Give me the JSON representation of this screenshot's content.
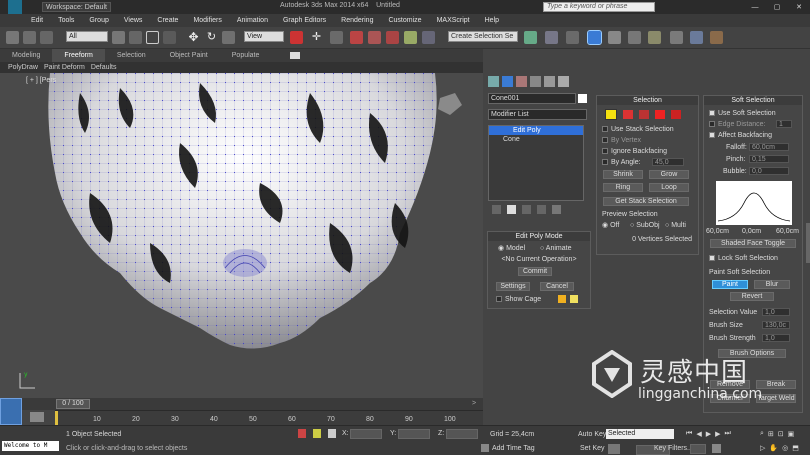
{
  "title_bar": {
    "workspace": "Workspace: Default",
    "title": "Autodesk 3ds Max  2014 x64",
    "doc": "Untitled",
    "search_placeholder": "Type a keyword or phrase"
  },
  "menu": [
    "Edit",
    "Tools",
    "Group",
    "Views",
    "Create",
    "Modifiers",
    "Animation",
    "Graph Editors",
    "Rendering",
    "Customize",
    "MAXScript",
    "Help"
  ],
  "toolbar": {
    "filter": "All",
    "coord": "View",
    "selection_set": "Create Selection Se"
  },
  "ribbon": {
    "tabs": [
      "Modeling",
      "Freeform",
      "Selection",
      "Object Paint",
      "Populate"
    ],
    "active": "Freeform",
    "subtabs": [
      "PolyDraw",
      "Paint Deform",
      "Defaults"
    ]
  },
  "viewport": {
    "label": "[ + ] [Pers"
  },
  "command_panel": {
    "object_name": "Cone001",
    "modifier_list": "Modifier List",
    "stack": [
      "Edit Poly",
      "Cone"
    ],
    "edit_poly_mode": {
      "title": "Edit Poly Mode",
      "model": "Model",
      "animate": "Animate",
      "current_op": "<No Current Operation>",
      "commit": "Commit",
      "settings": "Settings",
      "cancel": "Cancel",
      "show_cage": "Show Cage"
    },
    "selection": {
      "title": "Selection",
      "use_stack": "Use Stack Selection",
      "by_vertex": "By Vertex",
      "ignore_backfacing": "Ignore Backfacing",
      "by_angle": "By Angle:",
      "angle_value": "45,0",
      "shrink": "Shrink",
      "grow": "Grow",
      "ring": "Ring",
      "loop": "Loop",
      "get_stack": "Get Stack Selection",
      "preview_title": "Preview Selection",
      "off": "Off",
      "subobj": "SubObj",
      "multi": "Multi",
      "vertices_selected": "0 Vertices Selected"
    },
    "soft_selection": {
      "title": "Soft Selection",
      "use_soft": "Use Soft Selection",
      "edge_distance": "Edge Distance:",
      "edge_value": "1",
      "affect_backfacing": "Affect Backfacing",
      "falloff": "Falloff:",
      "falloff_value": "60,0cm",
      "pinch": "Pinch:",
      "pinch_value": "0,15",
      "bubble": "Bubble:",
      "bubble_value": "0,0",
      "curve_labels": [
        "60,0cm",
        "0,0cm",
        "60,0cm"
      ],
      "shaded_face": "Shaded Face Toggle",
      "lock_soft": "Lock Soft Selection",
      "paint_title": "Paint Soft Selection",
      "paint": "Paint",
      "blur": "Blur",
      "revert": "Revert",
      "selection_value": "Selection Value",
      "selection_value_num": "1,0",
      "brush_size": "Brush Size",
      "brush_size_num": "130,0c",
      "brush_strength": "Brush Strength",
      "brush_strength_num": "1,0",
      "brush_options": "Brush Options",
      "remove": "Remove",
      "break": "Break",
      "chamfer": "Chamfer",
      "target_weld": "Target Weld"
    }
  },
  "timeline": {
    "frame": "0 / 100",
    "ticks": [
      "10",
      "20",
      "30",
      "40",
      "50",
      "60",
      "70",
      "80",
      "90",
      "100"
    ]
  },
  "status": {
    "maxscript": "Welcome to M",
    "selected": "1 Object Selected",
    "prompt": "Click or click-and-drag to select objects",
    "x_label": "X:",
    "y_label": "Y:",
    "z_label": "Z:",
    "grid": "Grid = 25,4cm",
    "add_time_tag": "Add Time Tag",
    "auto_key": "Auto Key",
    "set_key": "Set Key",
    "selected_dropdown": "Selected",
    "key_filters": "Key Filters..."
  },
  "watermark": {
    "cn": "灵感中国",
    "url": "lingganchina.com"
  },
  "colors": {
    "accent": "#2f8fd8",
    "selected_item": "#2f6fd8",
    "vertex": "#3d3dc8"
  }
}
